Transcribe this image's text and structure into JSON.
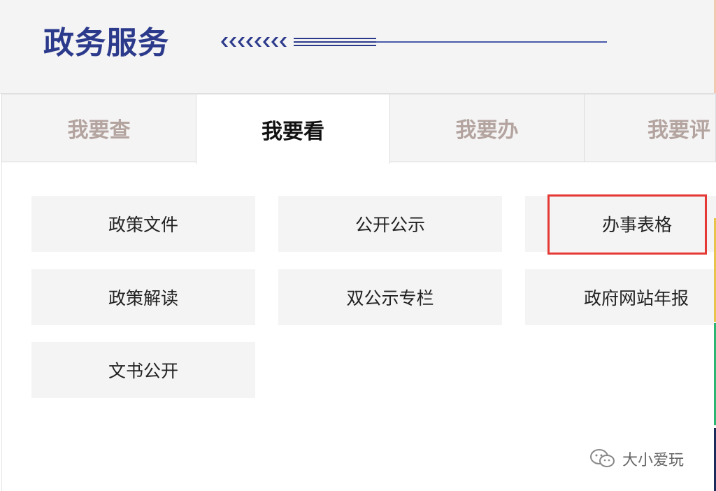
{
  "section": {
    "title": "政务服务"
  },
  "tabs": [
    {
      "label": "我要查",
      "active": false
    },
    {
      "label": "我要看",
      "active": true
    },
    {
      "label": "我要办",
      "active": false
    },
    {
      "label": "我要评",
      "active": false
    }
  ],
  "items": [
    {
      "label": "政策文件"
    },
    {
      "label": "公开公示"
    },
    {
      "label": "办事表格",
      "highlighted": true
    },
    {
      "label": "政策解读"
    },
    {
      "label": "双公示专栏"
    },
    {
      "label": "政府网站年报"
    },
    {
      "label": "文书公开"
    }
  ],
  "watermark": {
    "text": "大小爱玩",
    "icon": "wechat-icon"
  },
  "colors": {
    "title": "#2c3a8c",
    "tab_inactive_text": "#b4a4a0",
    "tab_active_text": "#111111",
    "highlight": "#e53935",
    "edge_strips": [
      "#f2c9b0",
      "#e8c44a",
      "#2bb673",
      "#1d2b5a"
    ]
  }
}
